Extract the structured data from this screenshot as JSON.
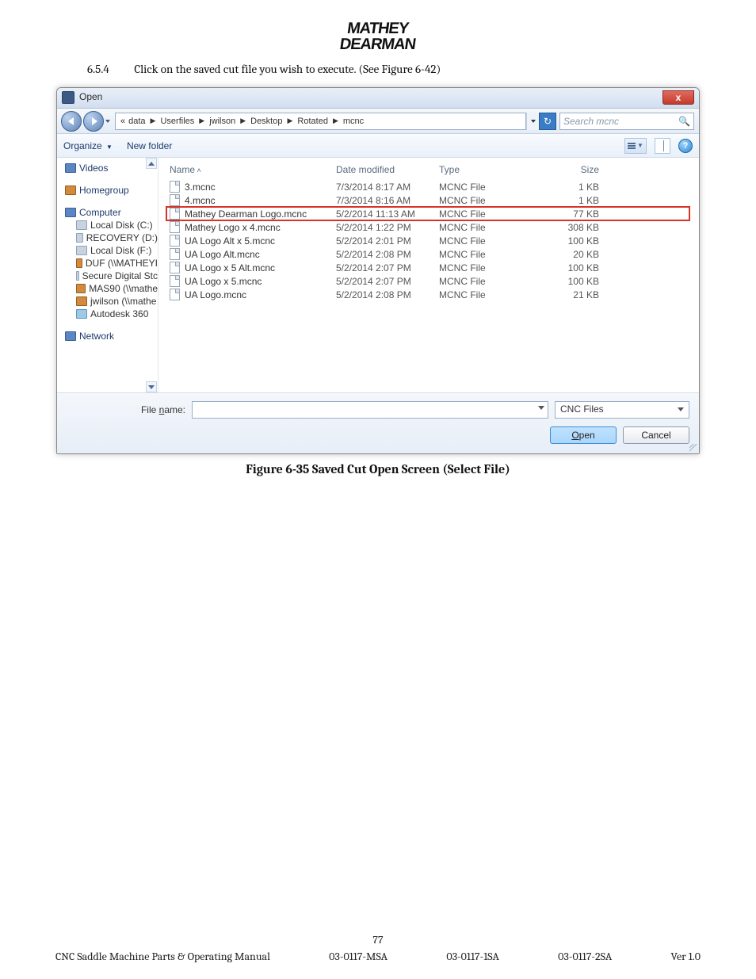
{
  "logo": {
    "line1": "MATHEY",
    "line2": "DEARMAN"
  },
  "instruction": {
    "number": "6.5.4",
    "text": "Click on the saved cut file you wish to execute. (See Figure 6-42)"
  },
  "dialog": {
    "title": "Open",
    "close_glyph": "x",
    "breadcrumb": {
      "lead": "«",
      "parts": [
        "data",
        "Userfiles",
        "jwilson",
        "Desktop",
        "Rotated",
        "mcnc"
      ]
    },
    "refresh_glyph": "↻",
    "search_placeholder": "Search mcnc",
    "search_glyph": "🔍",
    "toolbar": {
      "organize": "Organize",
      "newfolder": "New folder",
      "help_glyph": "?"
    },
    "sidebar": [
      {
        "label": "Videos",
        "icon": "tree"
      },
      {
        "label": "",
        "spacer": true
      },
      {
        "label": "Homegroup",
        "icon": "net"
      },
      {
        "label": "",
        "spacer": true
      },
      {
        "label": "Computer",
        "icon": "tree"
      },
      {
        "label": "Local Disk (C:)",
        "icon": "drive",
        "sub": true
      },
      {
        "label": "RECOVERY (D:)",
        "icon": "drive",
        "sub": true
      },
      {
        "label": "Local Disk (F:)",
        "icon": "drive",
        "sub": true
      },
      {
        "label": "DUF (\\\\MATHEYI",
        "icon": "net",
        "sub": true
      },
      {
        "label": "Secure Digital Stc",
        "icon": "drive",
        "sub": true
      },
      {
        "label": "MAS90 (\\\\mathe",
        "icon": "net",
        "sub": true
      },
      {
        "label": "jwilson (\\\\mathe",
        "icon": "net",
        "sub": true
      },
      {
        "label": "Autodesk 360",
        "icon": "cloud",
        "sub": true
      },
      {
        "label": "",
        "spacer": true
      },
      {
        "label": "Network",
        "icon": "tree"
      }
    ],
    "columns": {
      "name": "Name",
      "date": "Date modified",
      "type": "Type",
      "size": "Size"
    },
    "rows": [
      {
        "name": "3.mcnc",
        "date": "7/3/2014 8:17 AM",
        "type": "MCNC File",
        "size": "1 KB",
        "hl": false
      },
      {
        "name": "4.mcnc",
        "date": "7/3/2014 8:16 AM",
        "type": "MCNC File",
        "size": "1 KB",
        "hl": false
      },
      {
        "name": "Mathey Dearman Logo.mcnc",
        "date": "5/2/2014 11:13 AM",
        "type": "MCNC File",
        "size": "77 KB",
        "hl": true
      },
      {
        "name": "Mathey Logo x 4.mcnc",
        "date": "5/2/2014 1:22 PM",
        "type": "MCNC File",
        "size": "308 KB",
        "hl": false
      },
      {
        "name": "UA Logo Alt x 5.mcnc",
        "date": "5/2/2014 2:01 PM",
        "type": "MCNC File",
        "size": "100 KB",
        "hl": false
      },
      {
        "name": "UA Logo Alt.mcnc",
        "date": "5/2/2014 2:08 PM",
        "type": "MCNC File",
        "size": "20 KB",
        "hl": false
      },
      {
        "name": "UA Logo x 5 Alt.mcnc",
        "date": "5/2/2014 2:07 PM",
        "type": "MCNC File",
        "size": "100 KB",
        "hl": false
      },
      {
        "name": "UA Logo x 5.mcnc",
        "date": "5/2/2014 2:07 PM",
        "type": "MCNC File",
        "size": "100 KB",
        "hl": false
      },
      {
        "name": "UA Logo.mcnc",
        "date": "5/2/2014 2:08 PM",
        "type": "MCNC File",
        "size": "21 KB",
        "hl": false
      }
    ],
    "filename_label_pre": "File ",
    "filename_label_u": "n",
    "filename_label_post": "ame:",
    "filter": "CNC Files",
    "open_u": "O",
    "open_rest": "pen",
    "cancel": "Cancel"
  },
  "caption": "Figure 6-35 Saved Cut Open Screen (Select File)",
  "footer": {
    "page": "77",
    "left": "CNC Saddle Machine Parts & Operating Manual",
    "c1": "03-0117-MSA",
    "c2": "03-0117-1SA",
    "c3": "03-0117-2SA",
    "right": "Ver 1.0"
  }
}
